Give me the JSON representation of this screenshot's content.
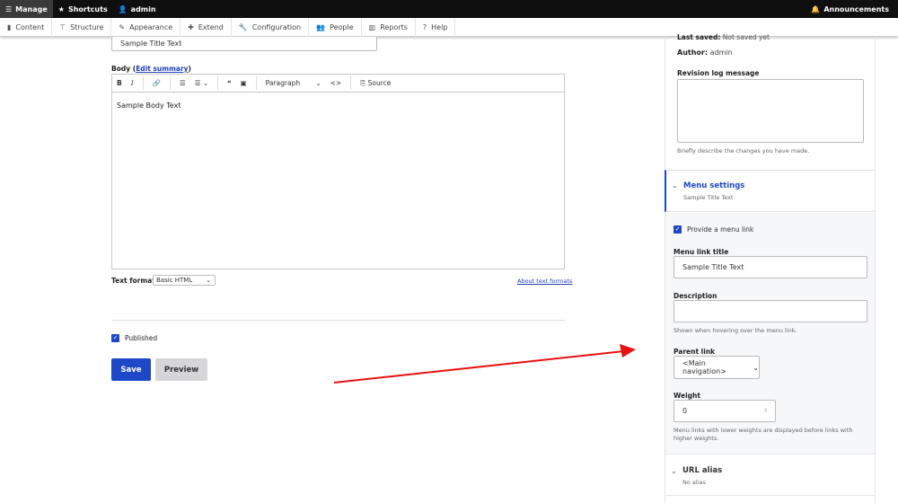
{
  "topbar": {
    "manage": "Manage",
    "shortcuts": "Shortcuts",
    "user": "admin",
    "announcements": "Announcements"
  },
  "adminbar": {
    "items": [
      {
        "label": "Content",
        "icon": "file-icon"
      },
      {
        "label": "Structure",
        "icon": "sitemap-icon"
      },
      {
        "label": "Appearance",
        "icon": "brush-icon"
      },
      {
        "label": "Extend",
        "icon": "puzzle-icon"
      },
      {
        "label": "Configuration",
        "icon": "wrench-icon"
      },
      {
        "label": "People",
        "icon": "people-icon"
      },
      {
        "label": "Reports",
        "icon": "bar-chart-icon"
      },
      {
        "label": "Help",
        "icon": "help-icon"
      }
    ]
  },
  "form": {
    "title_value": "Sample Title Text",
    "body_label": "Body",
    "edit_summary": "Edit summary",
    "toolbar": {
      "paragraph": "Paragraph",
      "source": "Source"
    },
    "body_value": "Sample Body Text",
    "text_format_label": "Text format",
    "text_format_value": "Basic HTML",
    "about_text_formats": "About text formats",
    "published_label": "Published",
    "save": "Save",
    "preview": "Preview"
  },
  "sidebar": {
    "last_saved_label": "Last saved:",
    "last_saved_value": "Not saved yet",
    "author_label": "Author:",
    "author_value": "admin",
    "revision_label": "Revision log message",
    "revision_help": "Briefly describe the changes you have made.",
    "menu_settings": {
      "title": "Menu settings",
      "summary": "Sample Title Text",
      "provide_label": "Provide a menu link",
      "link_title_label": "Menu link title",
      "link_title_value": "Sample Title Text",
      "description_label": "Description",
      "description_help": "Shown when hovering over the menu link.",
      "parent_label": "Parent link",
      "parent_value": "<Main navigation>",
      "weight_label": "Weight",
      "weight_value": "0",
      "weight_help": "Menu links with lower weights are displayed before links with higher weights."
    },
    "url_alias": {
      "title": "URL alias",
      "summary": "No alias"
    }
  },
  "colors": {
    "accent": "#1e48c8",
    "annotation_arrow": "#e81010"
  }
}
